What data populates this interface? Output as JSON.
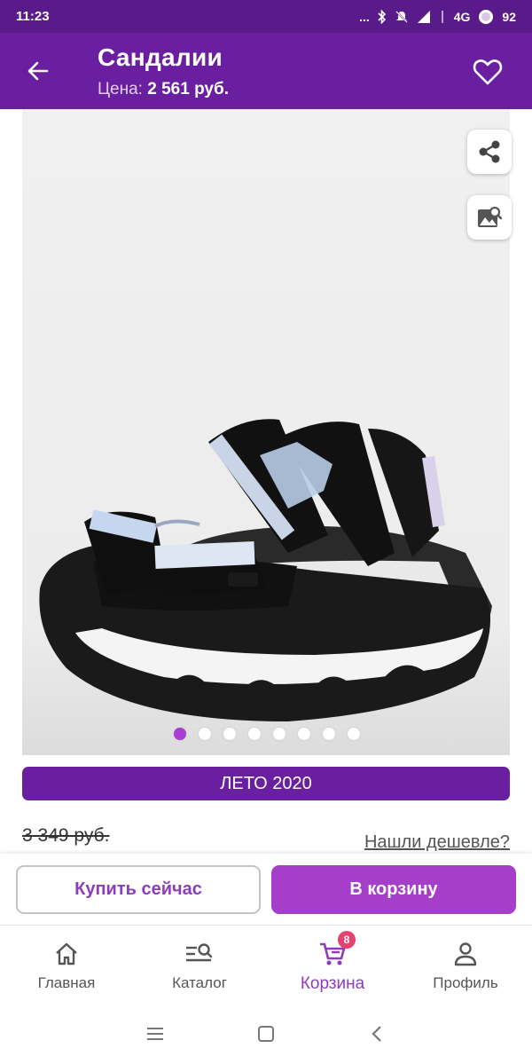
{
  "status_bar": {
    "time": "11:23",
    "dots": "...",
    "network": "4G",
    "battery": "92"
  },
  "app_bar": {
    "title": "Сандалии",
    "price_label": "Цена:",
    "price_value": "2 561 руб."
  },
  "gallery": {
    "image_description": "sandals-photo",
    "total_images": 8,
    "active_index": 0
  },
  "promo": {
    "label": "ЛЕТО 2020"
  },
  "pricing": {
    "old_price": "3 349 руб.",
    "cheaper_link": "Нашли дешевле?"
  },
  "actions": {
    "buy_now_label": "Купить сейчас",
    "to_cart_label": "В корзину"
  },
  "bottom_nav": {
    "items": [
      {
        "label": "Главная",
        "icon": "home-icon"
      },
      {
        "label": "Каталог",
        "icon": "catalog-search-icon"
      },
      {
        "label": "Корзина",
        "icon": "cart-icon",
        "badge": "8",
        "active": true
      },
      {
        "label": "Профиль",
        "icon": "profile-icon"
      }
    ]
  },
  "colors": {
    "primary": "#6a1fa0",
    "status_bar": "#5a1b8a",
    "accent": "#a53ec9",
    "badge": "#e8416f"
  }
}
